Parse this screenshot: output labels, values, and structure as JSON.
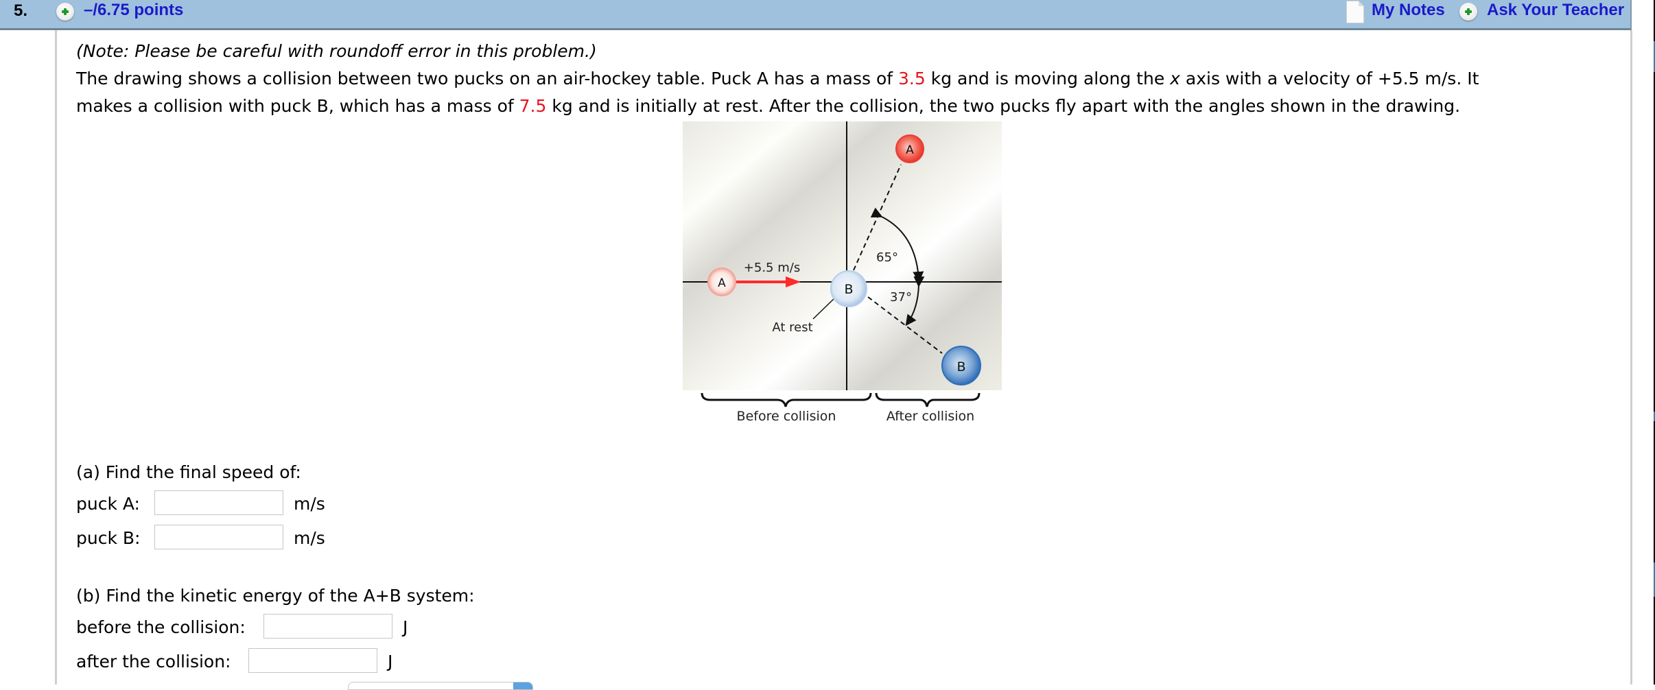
{
  "question": {
    "number": "5.",
    "points": "–/6.75 points",
    "plus_icon": "plus-circle-icon",
    "links": {
      "my_notes": "My Notes",
      "my_notes_icon": "notes-page-icon",
      "ask_teacher": "Ask Your Teacher",
      "ask_teacher_icon": "plus-circle-icon"
    }
  },
  "problem": {
    "note": "(Note: Please be careful with roundoff error in this problem.)",
    "text_1": "The drawing shows a collision between two pucks on an air-hockey table. Puck A has a mass of ",
    "mass_a": "3.5",
    "text_2": " kg and is moving along the ",
    "axis_var": "x",
    "text_3": " axis with a velocity of +5.5 m/s. It",
    "text_4": "makes a collision with puck B, which has a mass of ",
    "mass_b": "7.5",
    "text_5": " kg and is initially at rest. After the collision, the two pucks fly apart with the angles shown in the drawing.",
    "highlight_color": "#e8141b"
  },
  "diagram": {
    "puck_a_label": "A",
    "puck_b_label": "B",
    "velocity_label": "+5.5 m/s",
    "at_rest_label": "At rest",
    "angle_a_label": "65°",
    "angle_b_label": "37°",
    "before_label": "Before collision",
    "after_label": "After collision",
    "angle_a_deg": 65,
    "angle_b_deg": 37,
    "colors": {
      "puck_a": "#f0453c",
      "puck_b": "#3c79c0",
      "arrow": "#ff2a2a"
    }
  },
  "part_a": {
    "prompt": "(a) Find the final speed of:",
    "fields": [
      {
        "label": "puck A:",
        "value": "",
        "unit": "m/s"
      },
      {
        "label": "puck B:",
        "value": "",
        "unit": "m/s"
      }
    ]
  },
  "part_b": {
    "prompt": "(b) Find the kinetic energy of the A+B system:",
    "fields": [
      {
        "label": "before the collision:",
        "value": "",
        "unit": "J"
      },
      {
        "label": "after the collision:",
        "value": "",
        "unit": "J"
      }
    ]
  }
}
